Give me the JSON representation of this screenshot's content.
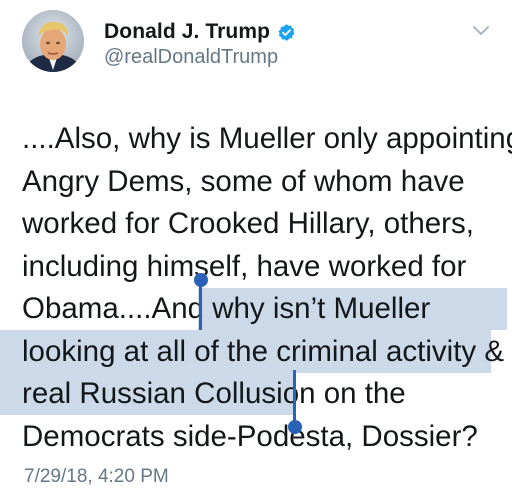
{
  "author": {
    "display_name": "Donald J. Trump",
    "handle": "@realDonaldTrump",
    "verified": true,
    "verified_icon": "verified-badge-icon",
    "verified_color": "#1da1f2"
  },
  "menu": {
    "icon": "chevron-down-icon"
  },
  "tweet": {
    "lines": [
      "....Also, why is Mueller only appointing",
      "Angry Dems, some of whom have",
      "worked for Crooked Hillary, others,",
      "including himself, have worked for",
      "Obama....And why isn’t Mueller",
      "looking at all of the criminal activity &",
      "real Russian Collusion on the",
      "Democrats side-Podesta, Dossier?"
    ],
    "selected_text": "why isn’t Mueller looking at all of the criminal activity & real Russian Collusion",
    "timestamp": "7/29/18, 4:20 PM"
  },
  "colors": {
    "text": "#14171a",
    "secondary": "#657786",
    "selection": "#a0b9d7",
    "selection_handle": "#2a62b8"
  }
}
